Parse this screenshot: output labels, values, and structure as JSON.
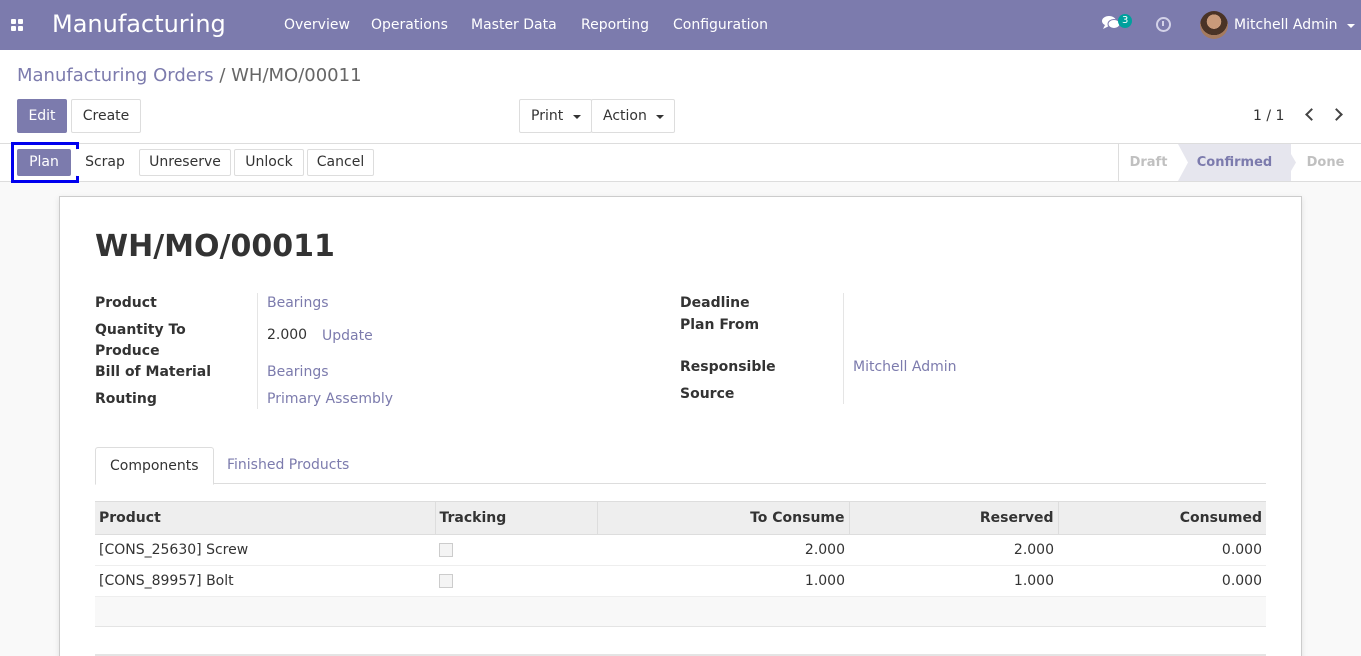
{
  "navbar": {
    "app_name": "Manufacturing",
    "menu": [
      "Overview",
      "Operations",
      "Master Data",
      "Reporting",
      "Configuration"
    ],
    "chat_count": "3",
    "user": "Mitchell Admin"
  },
  "breadcrumb": {
    "parent": "Manufacturing Orders",
    "separator": " / ",
    "current": "WH/MO/00011"
  },
  "buttons": {
    "edit": "Edit",
    "create": "Create",
    "print": "Print",
    "action": "Action"
  },
  "pager": {
    "value": "1 / 1"
  },
  "status_buttons": {
    "plan": "Plan",
    "scrap": "Scrap",
    "unreserve": "Unreserve",
    "unlock": "Unlock",
    "cancel": "Cancel"
  },
  "stages": [
    "Draft",
    "Confirmed",
    "Done"
  ],
  "form": {
    "title": "WH/MO/00011",
    "product_label": "Product",
    "product": "Bearings",
    "qty_label": "Quantity To Produce",
    "qty": "2.000",
    "update": "Update",
    "bom_label": "Bill of Material",
    "bom": "Bearings",
    "routing_label": "Routing",
    "routing": "Primary Assembly",
    "deadline_label": "Deadline",
    "plan_from_label": "Plan From",
    "responsible_label": "Responsible",
    "responsible": "Mitchell Admin",
    "source_label": "Source"
  },
  "tabs": {
    "components": "Components",
    "finished": "Finished Products"
  },
  "table": {
    "headers": [
      "Product",
      "Tracking",
      "To Consume",
      "Reserved",
      "Consumed"
    ],
    "rows": [
      {
        "product": "[CONS_25630] Screw",
        "to_consume": "2.000",
        "reserved": "2.000",
        "consumed": "0.000"
      },
      {
        "product": "[CONS_89957] Bolt",
        "to_consume": "1.000",
        "reserved": "1.000",
        "consumed": "0.000"
      }
    ]
  }
}
